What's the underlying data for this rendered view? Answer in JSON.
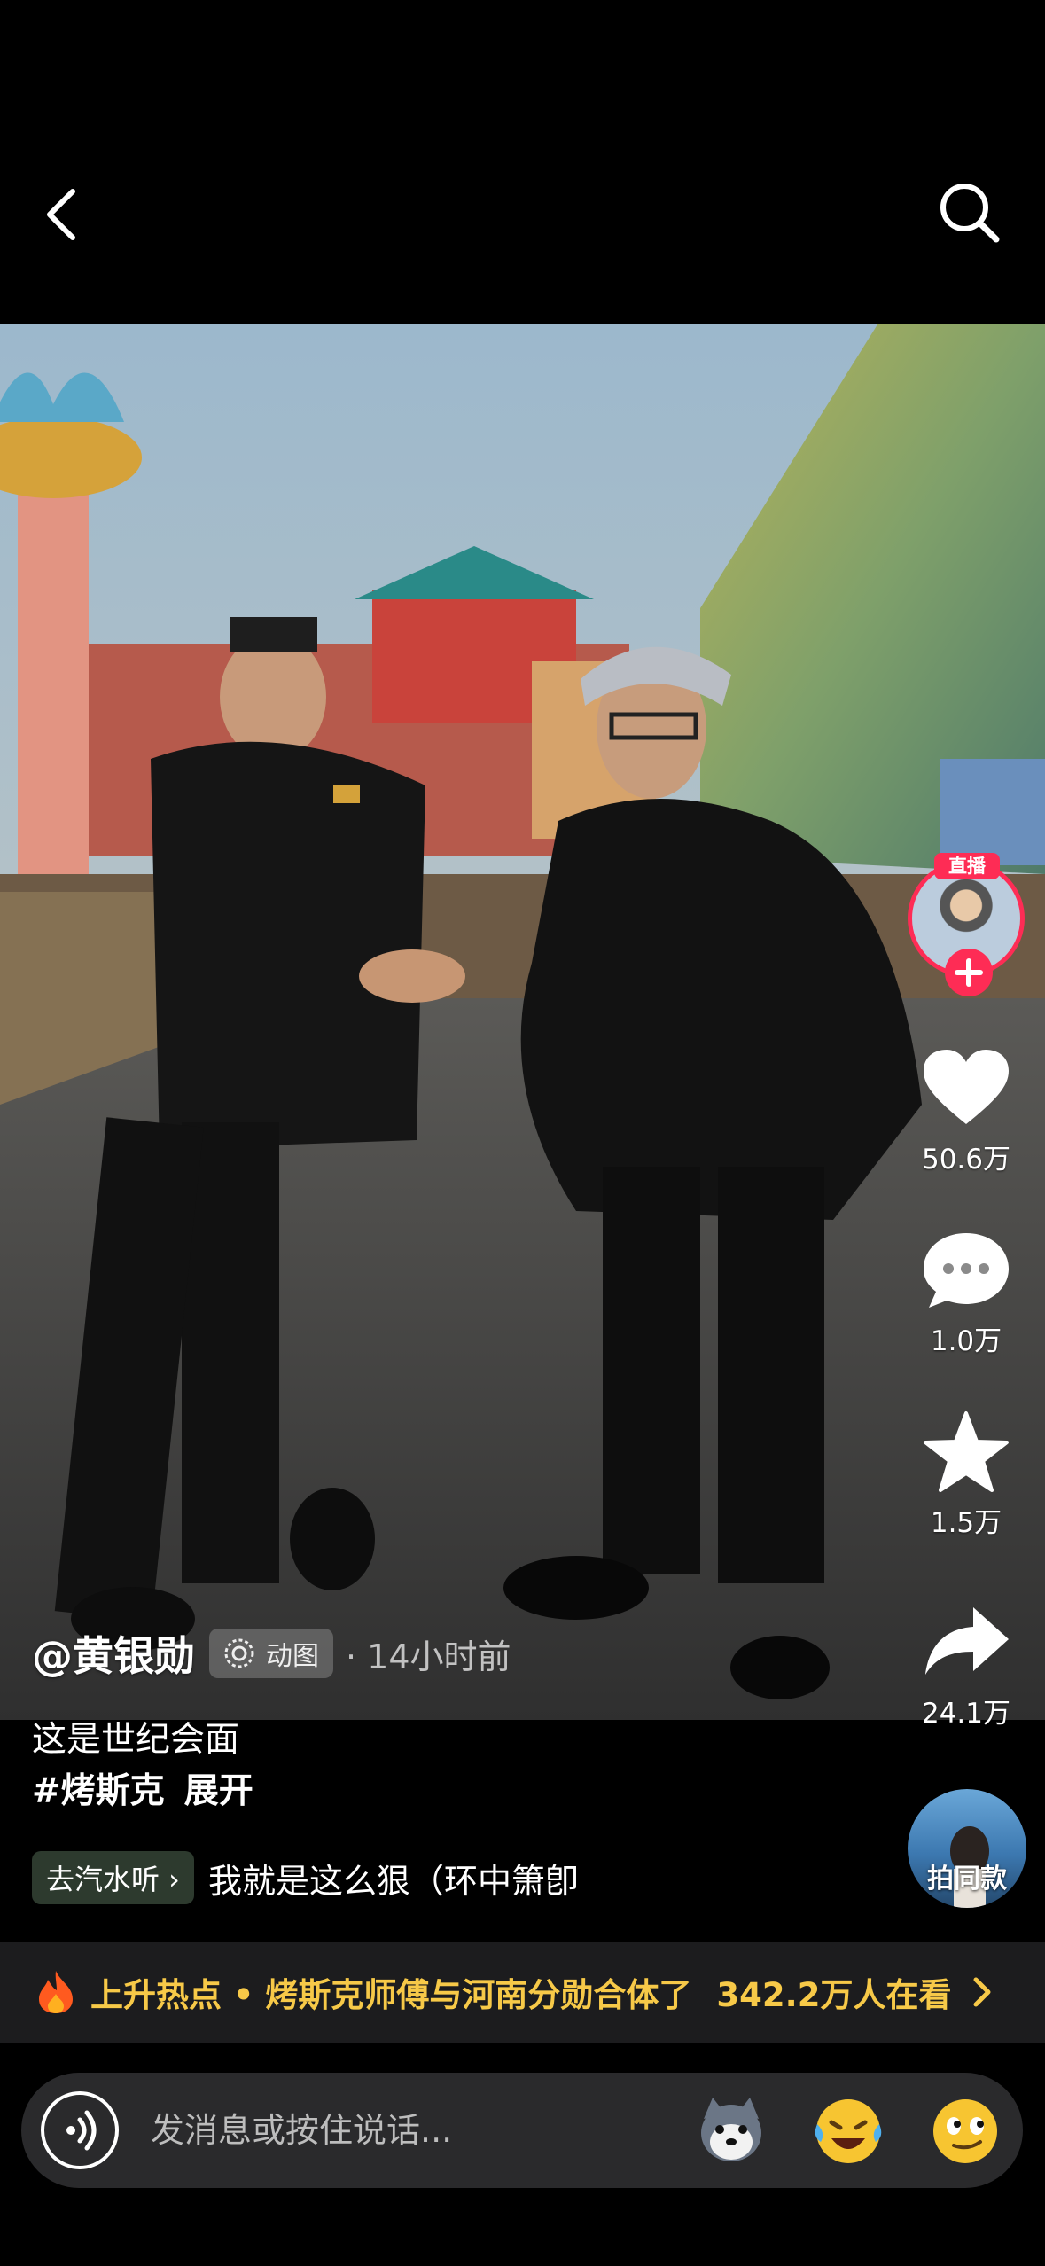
{
  "topbar": {
    "back_icon": "chevron-left-icon",
    "search_icon": "search-icon"
  },
  "rail": {
    "live_badge": "直播",
    "like_count": "50.6万",
    "comment_count": "1.0万",
    "favorite_count": "1.5万",
    "share_count": "24.1万",
    "accent_color": "#fe2c55"
  },
  "post": {
    "author": "@黄银勋",
    "media_tag": "动图",
    "time_ago": "· 14小时前",
    "caption_line1": "这是世纪会面",
    "hashtag": "#烤斯克",
    "expand_label": "展开"
  },
  "music": {
    "chip_label": "去汽水听 ›",
    "title": "我就是这么狠（环中箫卽"
  },
  "same_style": {
    "label": "拍同款"
  },
  "hot": {
    "text": "上升热点 • 烤斯克师傅与河南分勋合体了",
    "count": "342.2万人在看",
    "color": "#f7c948"
  },
  "composer": {
    "placeholder": "发消息或按住说话...",
    "emojis": [
      "husky-emoji-icon",
      "laughing-crying-emoji-icon",
      "smirk-emoji-icon"
    ]
  }
}
